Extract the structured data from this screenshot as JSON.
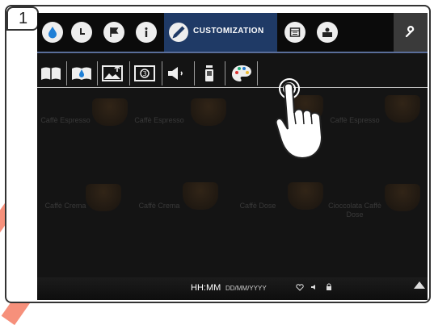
{
  "step": {
    "number": "1"
  },
  "topbar": {
    "active_tab_label": "CUSTOMIZATION",
    "icons": [
      "drop-icon",
      "clock-icon",
      "flag-icon",
      "info-icon",
      "pencil-icon",
      "calendar-icon",
      "user-card-icon",
      "wrench-icon"
    ]
  },
  "subbar": {
    "icons": [
      "book-icon",
      "book-drop-icon",
      "image-upload-icon",
      "screensaver-icon",
      "speaker-icon",
      "cup-sizes-icon",
      "palette-icon"
    ]
  },
  "background": {
    "labels": [
      "Caffè Espresso",
      "Caffè Espresso",
      "Caffè Espresso",
      "Caffè Crema",
      "Caffè Crema",
      "Caffè Dose",
      "Cioccolata Caffè Dose"
    ]
  },
  "statusbar": {
    "time": "HH:MM",
    "date": "DD/MM/YYYY"
  },
  "colors": {
    "active_tab": "#1f3a66",
    "accent_stripe": "#f36b4f",
    "topbar_border": "#5a6e9a"
  }
}
